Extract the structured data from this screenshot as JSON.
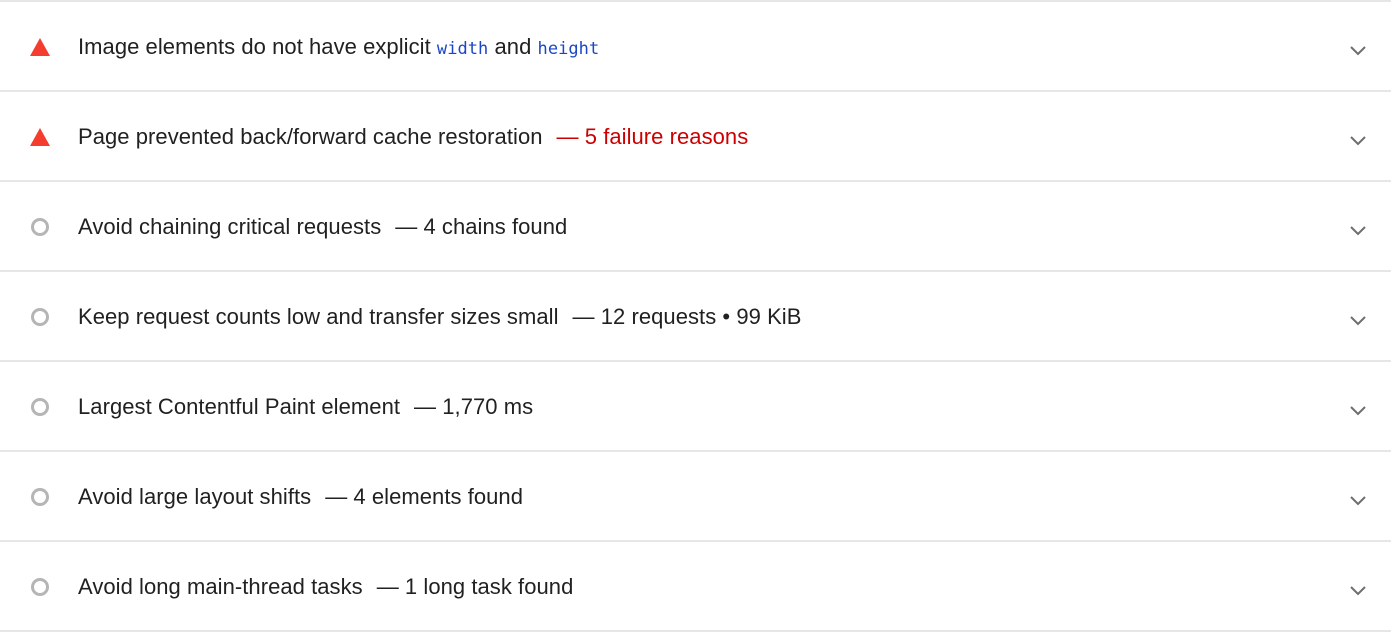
{
  "colors": {
    "fail": "#f33e2f",
    "fail_text": "#cc0000",
    "neutral": "#b5b5b5",
    "code": "#1a47c4",
    "divider": "#e6e6e6"
  },
  "audits": [
    {
      "status": "fail",
      "status_icon": "triangle-warning-icon",
      "title_prefix": "Image elements do not have explicit ",
      "code_1": "width",
      "title_middle": " and ",
      "code_2": "height",
      "display_value": ""
    },
    {
      "status": "fail",
      "status_icon": "triangle-warning-icon",
      "title": "Page prevented back/forward cache restoration",
      "display_value": "— 5 failure reasons"
    },
    {
      "status": "informative",
      "status_icon": "circle-icon",
      "title": "Avoid chaining critical requests",
      "display_value": "— 4 chains found"
    },
    {
      "status": "informative",
      "status_icon": "circle-icon",
      "title": "Keep request counts low and transfer sizes small",
      "display_value": "— 12 requests • 99 KiB"
    },
    {
      "status": "informative",
      "status_icon": "circle-icon",
      "title": "Largest Contentful Paint element",
      "display_value": "— 1,770 ms"
    },
    {
      "status": "informative",
      "status_icon": "circle-icon",
      "title": "Avoid large layout shifts",
      "display_value": "— 4 elements found"
    },
    {
      "status": "informative",
      "status_icon": "circle-icon",
      "title": "Avoid long main-thread tasks",
      "display_value": "— 1 long task found"
    }
  ]
}
